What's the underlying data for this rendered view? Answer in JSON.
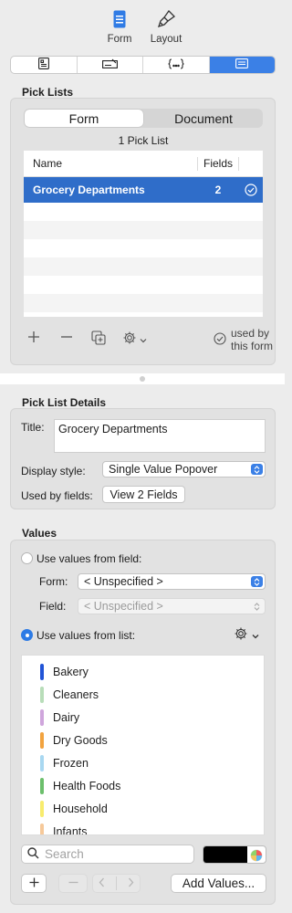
{
  "toolbar": {
    "form_label": "Form",
    "layout_label": "Layout"
  },
  "inspector_tabs": [
    "form-properties-icon",
    "field-editor-icon",
    "script-icon",
    "pick-list-icon"
  ],
  "pick_lists": {
    "section_title": "Pick Lists",
    "scope_tabs": [
      "Form",
      "Document"
    ],
    "count_label": "1 Pick List",
    "columns": {
      "name": "Name",
      "fields": "Fields"
    },
    "rows": [
      {
        "name": "Grocery Departments",
        "fields": "2",
        "checked": true
      }
    ],
    "used_by_label": "used by this form"
  },
  "details": {
    "section_title": "Pick List Details",
    "title_label": "Title:",
    "title_value": "Grocery Departments",
    "display_style_label": "Display style:",
    "display_style_value": "Single Value Popover",
    "used_by_fields_label": "Used by fields:",
    "view_fields_button": "View 2 Fields"
  },
  "values": {
    "section_title": "Values",
    "use_from_field_label": "Use values from field:",
    "form_label": "Form:",
    "form_value": "< Unspecified >",
    "field_label": "Field:",
    "field_value": "< Unspecified >",
    "use_from_list_label": "Use values from list:",
    "items": [
      {
        "label": "Bakery",
        "color": "#2154d6"
      },
      {
        "label": "Cleaners",
        "color": "#b8ddb9"
      },
      {
        "label": "Dairy",
        "color": "#cfa6dc"
      },
      {
        "label": "Dry Goods",
        "color": "#f2a33f"
      },
      {
        "label": "Frozen",
        "color": "#a9d8f1"
      },
      {
        "label": "Health Foods",
        "color": "#6cbf6c"
      },
      {
        "label": "Household",
        "color": "#f8ec6e"
      },
      {
        "label": "Infants",
        "color": "#f6c99a"
      }
    ],
    "search_placeholder": "Search",
    "add_values_button": "Add Values..."
  },
  "colors": {
    "accent": "#3b80e6",
    "selection": "#2f6dc9"
  }
}
